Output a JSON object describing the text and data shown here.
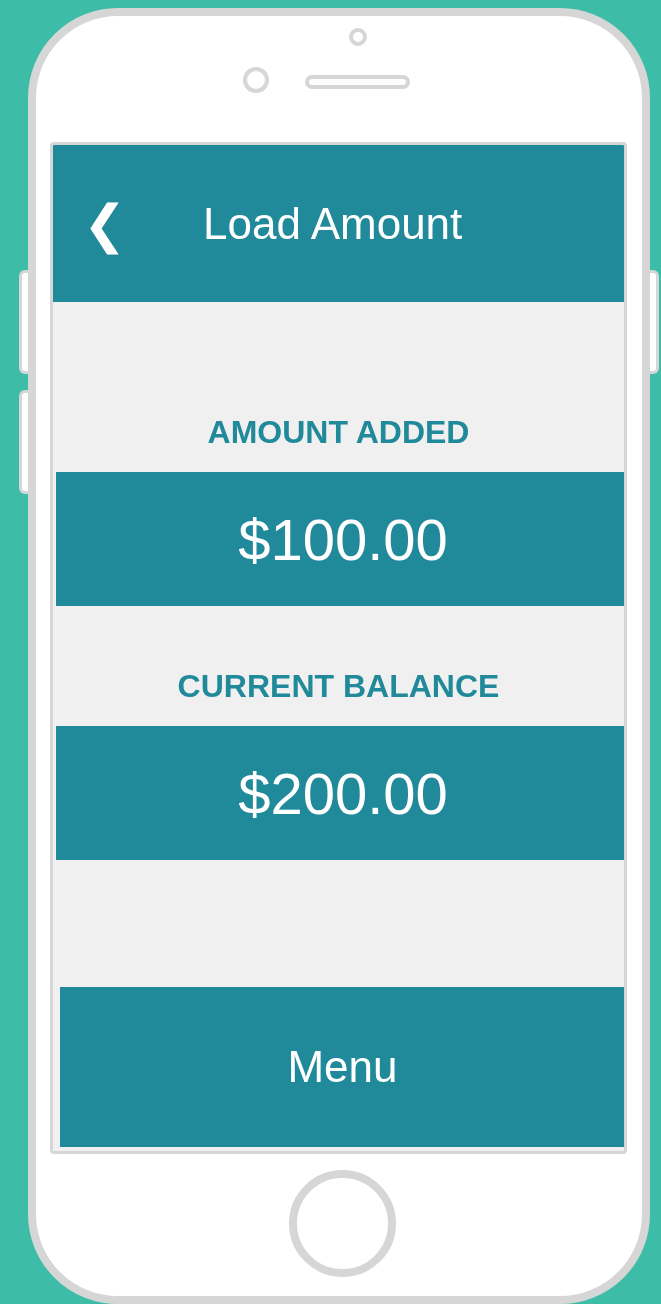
{
  "header": {
    "back_icon": "❮",
    "title": "Load Amount"
  },
  "fields": [
    {
      "label": "AMOUNT ADDED",
      "value": "$100.00"
    },
    {
      "label": "CURRENT BALANCE",
      "value": "$200.00"
    }
  ],
  "menu_button": "Menu"
}
